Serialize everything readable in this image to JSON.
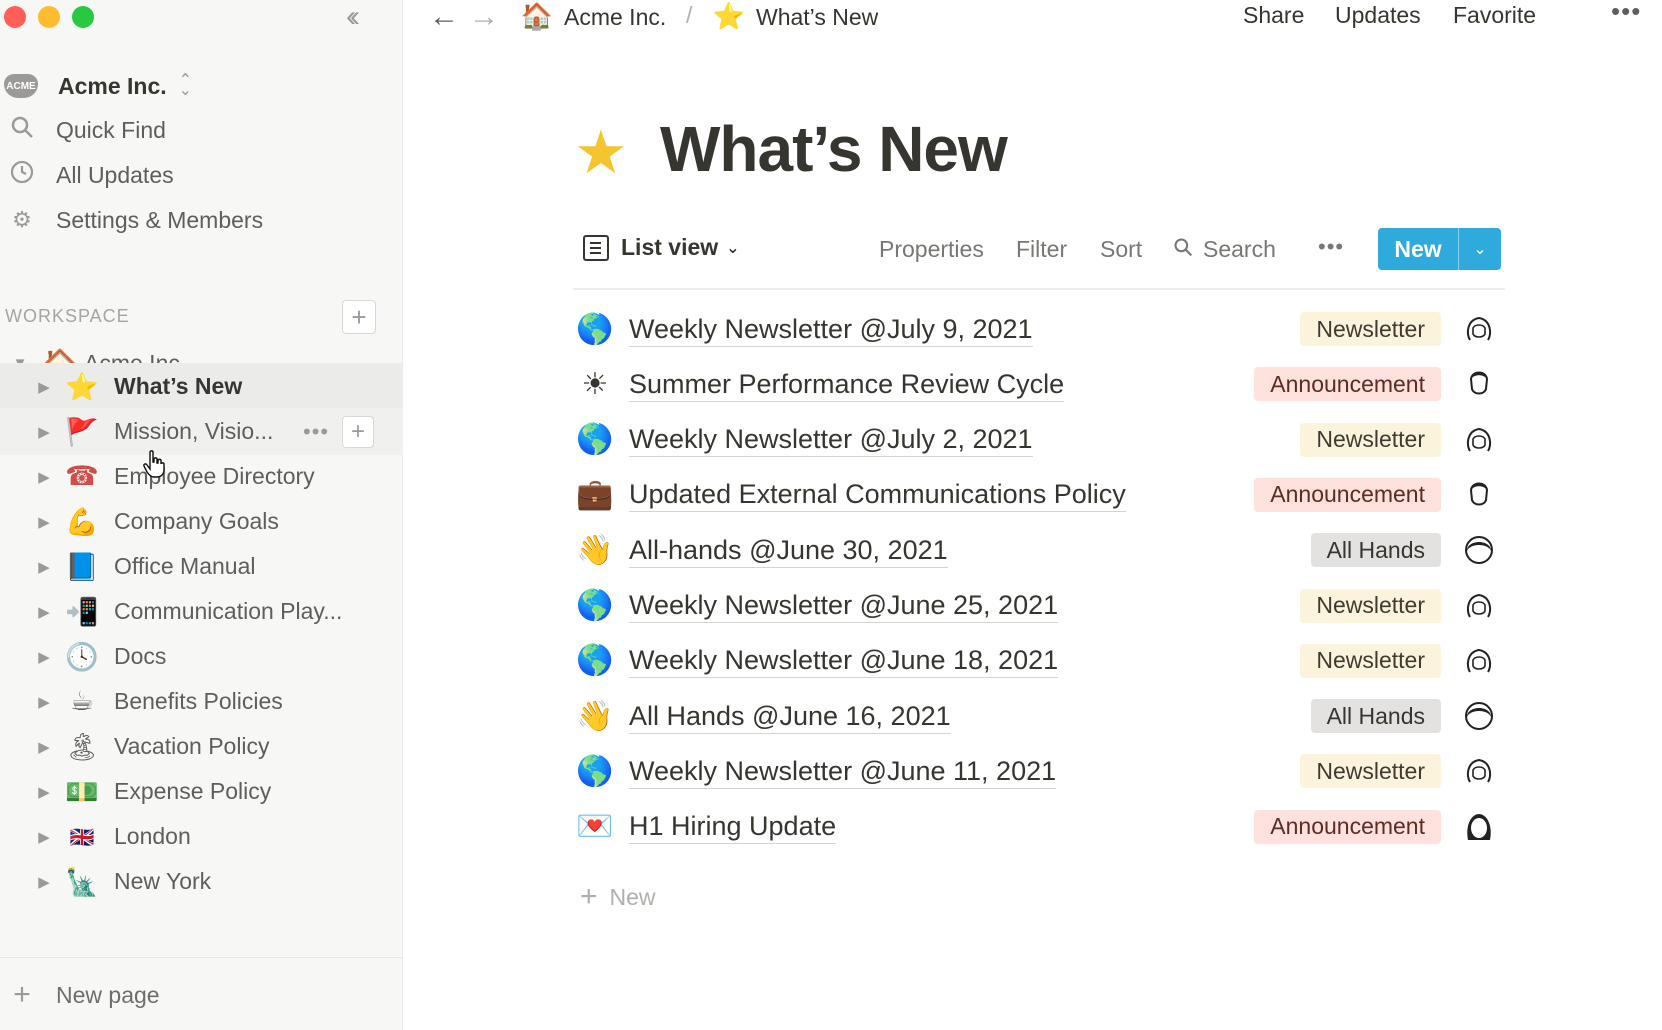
{
  "colors": {
    "close": "#ff5f57",
    "minimize": "#febc2e",
    "maximize": "#28c840",
    "accent": "#2eaadc",
    "tag_newsletter": "#fbf3db",
    "tag_announcement": "#ffe2dd",
    "tag_allhands": "#e3e2e0"
  },
  "sidebar": {
    "collapse_icon": "double-chevron-left-icon",
    "workspace": {
      "logo_text": "ACME",
      "name": "Acme Inc."
    },
    "nav": [
      {
        "icon": "search-icon",
        "label": "Quick Find"
      },
      {
        "icon": "clock-icon",
        "label": "All Updates"
      },
      {
        "icon": "gear-icon",
        "label": "Settings & Members"
      }
    ],
    "section_label": "WORKSPACE",
    "tree_root": {
      "emoji": "🏠",
      "label": "Acme Inc."
    },
    "pages": [
      {
        "emoji": "⭐",
        "label": "What’s New"
      },
      {
        "emoji": "🚩",
        "label": "Mission, Visio..."
      },
      {
        "emoji": "☎",
        "label": "Employee Directory"
      },
      {
        "emoji": "💪",
        "label": "Company Goals"
      },
      {
        "emoji": "📘",
        "label": "Office Manual"
      },
      {
        "emoji": "📲",
        "label": "Communication Play..."
      },
      {
        "emoji": "🕓",
        "label": "Docs"
      },
      {
        "emoji": "☕",
        "label": "Benefits Policies"
      },
      {
        "emoji": "🏝",
        "label": "Vacation Policy"
      },
      {
        "emoji": "💵",
        "label": "Expense Policy"
      },
      {
        "emoji": "🇬🇧",
        "label": "London"
      },
      {
        "emoji": "🗽",
        "label": "New York"
      }
    ],
    "new_page_label": "New page"
  },
  "topbar": {
    "breadcrumb": [
      {
        "emoji": "🏠",
        "label": "Acme Inc."
      },
      {
        "emoji": "⭐",
        "label": "What’s New"
      }
    ],
    "separator": "/",
    "actions": {
      "share": "Share",
      "updates": "Updates",
      "favorite": "Favorite"
    }
  },
  "page": {
    "icon": "★",
    "title": "What’s New",
    "view": {
      "name": "List view",
      "properties": "Properties",
      "filter": "Filter",
      "sort": "Sort",
      "search": "Search",
      "new_label": "New"
    },
    "rows": [
      {
        "emoji": "🌎",
        "title": "Weekly Newsletter @July 9, 2021",
        "tag": "Newsletter",
        "tag_type": "news"
      },
      {
        "emoji": "☀",
        "title": "Summer Performance Review Cycle",
        "tag": "Announcement",
        "tag_type": "ann"
      },
      {
        "emoji": "🌎",
        "title": "Weekly Newsletter @July 2, 2021",
        "tag": "Newsletter",
        "tag_type": "news"
      },
      {
        "emoji": "💼",
        "title": "Updated External Communications Policy",
        "tag": "Announcement",
        "tag_type": "ann"
      },
      {
        "emoji": "👋",
        "title": "All-hands @June 30, 2021",
        "tag": "All Hands",
        "tag_type": "all"
      },
      {
        "emoji": "🌎",
        "title": "Weekly Newsletter @June 25, 2021",
        "tag": "Newsletter",
        "tag_type": "news"
      },
      {
        "emoji": "🌎",
        "title": "Weekly Newsletter @June 18, 2021",
        "tag": "Newsletter",
        "tag_type": "news"
      },
      {
        "emoji": "👋",
        "title": "All Hands @June 16, 2021",
        "tag": "All Hands",
        "tag_type": "all"
      },
      {
        "emoji": "🌎",
        "title": "Weekly Newsletter @June 11, 2021",
        "tag": "Newsletter",
        "tag_type": "news"
      },
      {
        "emoji": "💌",
        "title": "H1 Hiring Update",
        "tag": "Announcement",
        "tag_type": "ann"
      }
    ],
    "add_row_label": "New"
  }
}
